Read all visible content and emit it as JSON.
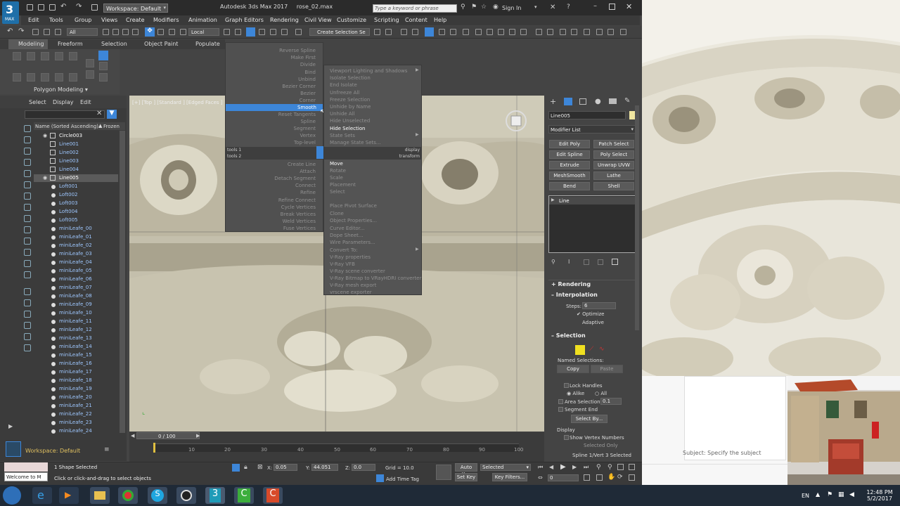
{
  "app": {
    "title": "Autodesk 3ds Max 2017",
    "file": "rose_02.max",
    "workspace": "Workspace: Default",
    "search_placeholder": "Type a keyword or phrase",
    "sign_in": "Sign In",
    "logo_label": "MAX"
  },
  "menu": [
    "Edit",
    "Tools",
    "Group",
    "Views",
    "Create",
    "Modifiers",
    "Animation",
    "Graph Editors",
    "Rendering",
    "Civil View",
    "Customize",
    "Scripting",
    "Content",
    "Help"
  ],
  "toolbar": {
    "filter": "All",
    "coord": "Local",
    "selection_set": "Create Selection Se"
  },
  "ribbon": {
    "tabs": [
      "Modeling",
      "Freeform",
      "Selection",
      "Object Paint",
      "Populate"
    ],
    "panel_label": "Polygon Modeling"
  },
  "scene": {
    "tabs": [
      "Select",
      "Display",
      "Edit"
    ],
    "col_name": "Name (Sorted Ascending)",
    "col_frozen": "Frozen",
    "items": [
      "Circle003",
      "Line001",
      "Line002",
      "Line003",
      "Line004",
      "Line005",
      "Loft001",
      "Loft002",
      "Loft003",
      "Loft004",
      "Loft005",
      "miniLeafe_00",
      "miniLeafe_01",
      "miniLeafe_02",
      "miniLeafe_03",
      "miniLeafe_04",
      "miniLeafe_05",
      "miniLeafe_06",
      "miniLeafe_07",
      "miniLeafe_08",
      "miniLeafe_09",
      "miniLeafe_10",
      "miniLeafe_11",
      "miniLeafe_12",
      "miniLeafe_13",
      "miniLeafe_14",
      "miniLeafe_15",
      "miniLeafe_16",
      "miniLeafe_17",
      "miniLeafe_18",
      "miniLeafe_19",
      "miniLeafe_20",
      "miniLeafe_21",
      "miniLeafe_22",
      "miniLeafe_23",
      "miniLeafe_24"
    ],
    "selected": "Line005",
    "workspace": "Workspace: Default"
  },
  "viewport": {
    "label": "[+] [Top ] [Standard ] [Edged Faces ]"
  },
  "quad_left": {
    "top_items": [
      "Reverse Spline",
      "Make First",
      "Divide",
      "Bind",
      "Unbind",
      "Bezier Corner",
      "Bezier",
      "Corner",
      "Smooth",
      "Reset Tangents",
      "Spline",
      "Segment",
      "Vertex",
      "Top-level"
    ],
    "highlighted": "Smooth",
    "tools1": "tools 1",
    "tools2": "tools 2",
    "bottom_items": [
      "Create Line",
      "Attach",
      "Detach Segment",
      "Connect",
      "Refine",
      "Refine Connect",
      "Cycle Vertices",
      "Break Vertices",
      "Weld Vertices",
      "Fuse Vertices"
    ]
  },
  "quad_right": {
    "display_items": [
      "Viewport Lighting and Shadows",
      "Isolate Selection",
      "End Isolate",
      "Unfreeze All",
      "Freeze Selection",
      "Unhide by Name",
      "Unhide All",
      "Hide Unselected",
      "Hide Selection",
      "State Sets",
      "Manage State Sets..."
    ],
    "display": "display",
    "transform": "transform",
    "transform_items": [
      "Move",
      "Rotate",
      "Scale",
      "Placement",
      "Select",
      "Place Pivot Surface",
      "Clone",
      "Object Properties...",
      "Curve Editor...",
      "Dope Sheet...",
      "Wire Parameters...",
      "Convert To:",
      "V-Ray properties",
      "V-Ray VFB",
      "V-Ray scene converter",
      "V-Ray Bitmap to VRayHDRI converter",
      "V-Ray mesh export",
      "vrscene exporter"
    ]
  },
  "command_panel": {
    "object_name": "Line005",
    "modifier_list": "Modifier List",
    "buttons": [
      "Edit Poly",
      "Patch Select",
      "Edit Spline",
      "Poly Select",
      "Extrude",
      "Unwrap UVW",
      "MeshSmooth",
      "Lathe",
      "Bend",
      "Shell"
    ],
    "stack_item": "Line",
    "rendering": "Rendering",
    "interpolation": "Interpolation",
    "steps_label": "Steps:",
    "steps_value": "6",
    "optimize": "Optimize",
    "adaptive": "Adaptive",
    "selection": "Selection",
    "named_selections": "Named Selections:",
    "copy": "Copy",
    "paste": "Paste",
    "lock_handles": "Lock Handles",
    "alike": "Alike",
    "all": "All",
    "area_selection": "Area Selection:",
    "area_value": "0.1",
    "segment_end": "Segment End",
    "select_by": "Select By...",
    "display": "Display",
    "show_vertex_numbers": "Show Vertex Numbers",
    "selected_only": "Selected Only",
    "status_line": "Spline 1/Vert 3 Selected"
  },
  "timeline": {
    "frame": "0 / 100",
    "ticks": [
      "10",
      "20",
      "30",
      "40",
      "50",
      "60",
      "70",
      "80",
      "90",
      "100"
    ]
  },
  "status": {
    "welcome": "Welcome to M",
    "shape_selected": "1 Shape Selected",
    "hint": "Click or click-and-drag to select objects",
    "x_label": "X:",
    "x": "0.05",
    "y_label": "Y:",
    "y": "44.051",
    "z_label": "Z:",
    "z": "0.0",
    "grid": "Grid = 10.0",
    "add_time_tag": "Add Time Tag",
    "auto_key": "Auto Key",
    "set_key": "Set Key",
    "selected": "Selected",
    "key_filters": "Key Filters...",
    "frame_field": "0"
  },
  "right_panel": {
    "subject": "Subject:  Specify the subject"
  },
  "taskbar": {
    "lang": "EN",
    "time": "12:48 PM",
    "date": "5/2/2017"
  },
  "colors": {
    "accent": "#3d86d8",
    "selected_row": "#5b5b5b",
    "viewport_bg": "#c9c5b3"
  }
}
